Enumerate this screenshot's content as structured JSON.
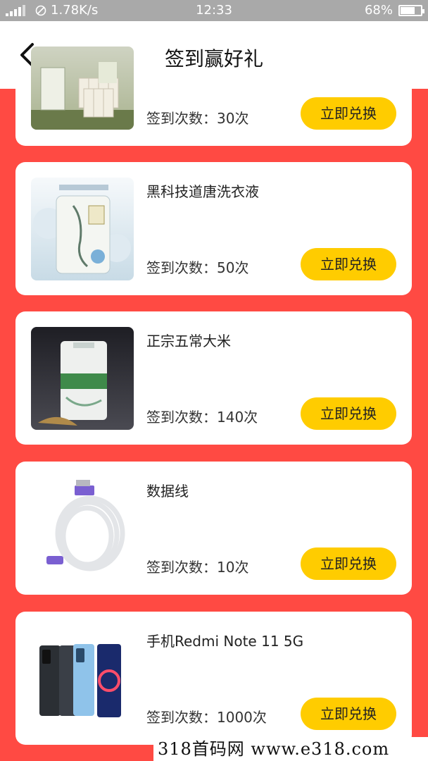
{
  "status_bar": {
    "network": "4G",
    "speed": "1.78K/s",
    "time": "12:33",
    "battery": "68%"
  },
  "header": {
    "back_icon": "chevron-left-icon",
    "title": "签到赢好礼"
  },
  "colors": {
    "page_bg": "#ff4a43",
    "button_bg": "#ffcc00",
    "card_bg": "#ffffff"
  },
  "products": [
    {
      "name": "",
      "count_label": "签到次数：30次",
      "button": "立即兑换",
      "image": "tissue-rolls-image"
    },
    {
      "name": "黑科技道唐洗衣液",
      "count_label": "签到次数：50次",
      "button": "立即兑换",
      "image": "detergent-bag-image"
    },
    {
      "name": "正宗五常大米",
      "count_label": "签到次数：140次",
      "button": "立即兑换",
      "image": "rice-bag-image"
    },
    {
      "name": "数据线",
      "count_label": "签到次数：10次",
      "button": "立即兑换",
      "image": "usb-cable-image"
    },
    {
      "name": "手机Redmi Note 11 5G",
      "count_label": "签到次数：1000次",
      "button": "立即兑换",
      "image": "smartphones-image"
    }
  ],
  "watermark": "318首码网 www.e318.com"
}
